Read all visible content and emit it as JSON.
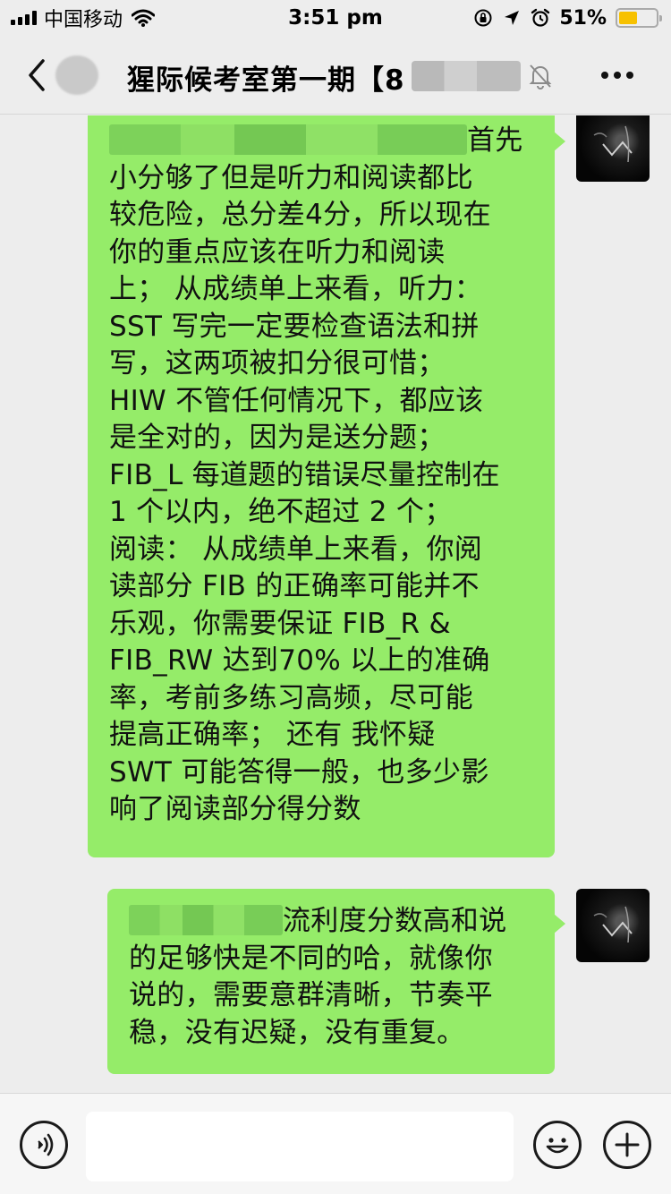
{
  "status_bar": {
    "carrier": "中国移动",
    "time": "3:51 pm",
    "battery_percent": "51%",
    "battery_level": 0.51,
    "battery_color": "#f7c100"
  },
  "nav": {
    "title": "猩际候考室第一期【8..."
  },
  "messages": [
    {
      "sender": "self",
      "bubble_color": "#95ec69",
      "lines": [
        "首先",
        "小分够了但是听力和阅读都比",
        "较危险，总分差4分，所以现在",
        "你的重点应该在听力和阅读",
        "上；  从成绩单上来看，听力：",
        "SST 写完一定要检查语法和拼",
        "写，这两项被扣分很可惜；",
        "HIW 不管任何情况下，都应该",
        "是全对的，因为是送分题；",
        "FIB_L 每道题的错误尽量控制在",
        " 1 个以内，绝不超过 2 个；",
        "阅读：  从成绩单上来看，你阅",
        "读部分 FIB 的正确率可能并不",
        "乐观，你需要保证 FIB_R &",
        "FIB_RW 达到70% 以上的准确",
        "率，考前多练习高频，尽可能",
        "提高正确率；  还有 我怀疑",
        "SWT 可能答得一般，也多少影",
        "响了阅读部分得分数"
      ]
    },
    {
      "sender": "self",
      "bubble_color": "#95ec69",
      "lines": [
        "流利度分数高和说",
        "的足够快是不同的哈，就像你",
        "说的，需要意群清晰，节奏平",
        "稳，没有迟疑，没有重复。"
      ]
    }
  ],
  "input_bar": {
    "placeholder": ""
  },
  "icons": {
    "back": "chevron-left-icon",
    "mute": "bell-slash-icon",
    "more": "more-dots-icon",
    "voice": "voice-icon",
    "emoji": "emoji-icon",
    "plus": "plus-icon"
  }
}
